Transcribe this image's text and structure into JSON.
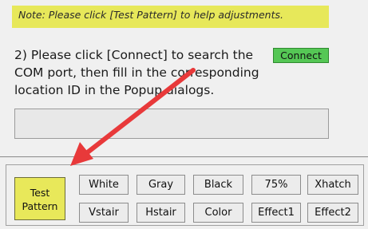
{
  "note": {
    "text": "Note: Please click [Test Pattern] to help adjustments."
  },
  "step2": {
    "text": "2) Please click [Connect] to search the COM port, then fill in the corresponding location ID in the Popup dialogs.",
    "connect_label": "Connect"
  },
  "location_input": {
    "value": ""
  },
  "patterns": {
    "test_pattern_line1": "Test",
    "test_pattern_line2": "Pattern",
    "row1": [
      "White",
      "Gray",
      "Black",
      "75%",
      "Xhatch"
    ],
    "row2": [
      "Vstair",
      "Hstair",
      "Color",
      "Effect1",
      "Effect2"
    ]
  },
  "colors": {
    "note_bg": "#e7e85a",
    "connect_bg": "#55c755",
    "test_pattern_bg": "#e8e85a",
    "arrow": "#e8393a"
  },
  "icons": {
    "annotation": "red-arrow-icon"
  }
}
